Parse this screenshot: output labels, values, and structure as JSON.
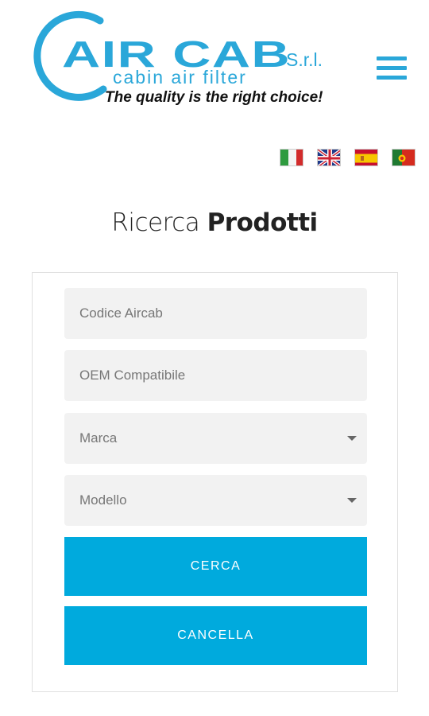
{
  "brand": {
    "logo_word": "AIR CAB",
    "logo_suffix": "S.r.l.",
    "logo_subtitle": "cabin air filter",
    "tagline": "The quality is the right choice!",
    "color": "#2aa7d9"
  },
  "nav": {
    "menu_icon": "hamburger-icon"
  },
  "languages": [
    {
      "code": "it",
      "icon": "italy-flag-icon"
    },
    {
      "code": "en",
      "icon": "uk-flag-icon"
    },
    {
      "code": "es",
      "icon": "spain-flag-icon"
    },
    {
      "code": "pt",
      "icon": "portugal-flag-icon"
    }
  ],
  "search": {
    "title_light": "Ricerca",
    "title_bold": "Prodotti",
    "code_placeholder": "Codice Aircab",
    "oem_placeholder": "OEM Compatibile",
    "brand_select": "Marca",
    "model_select": "Modello",
    "search_button": "CERCA",
    "clear_button": "CANCELLA",
    "button_color": "#00aadd"
  }
}
